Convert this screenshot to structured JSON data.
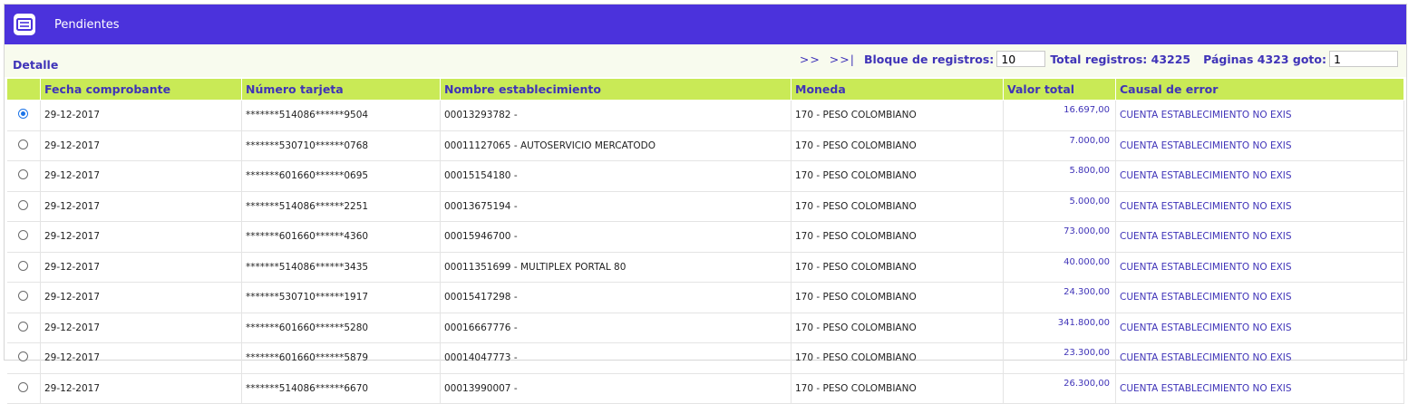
{
  "header": {
    "title": "Pendientes",
    "icon": "list-card-icon"
  },
  "toolbar": {
    "detail_label": "Detalle",
    "next_label": ">>",
    "last_label": ">>|",
    "block_label": "Bloque de registros:",
    "block_value": "10",
    "total_label": "Total registros: 43225",
    "pages_label": "Páginas 4323 goto:",
    "goto_value": "1"
  },
  "columns": [
    "",
    "Fecha comprobante",
    "Número tarjeta",
    "Nombre establecimiento",
    "Moneda",
    "Valor total",
    "Causal de error"
  ],
  "rows": [
    {
      "selected": true,
      "fecha": "29-12-2017",
      "tarjeta": "*******514086******9504",
      "establecimiento": "00013293782 -",
      "moneda": "170 - PESO COLOMBIANO",
      "valor": "16.697,00",
      "causal": "CUENTA ESTABLECIMIENTO NO EXIS"
    },
    {
      "selected": false,
      "fecha": "29-12-2017",
      "tarjeta": "*******530710******0768",
      "establecimiento": "00011127065 - AUTOSERVICIO MERCATODO",
      "moneda": "170 - PESO COLOMBIANO",
      "valor": "7.000,00",
      "causal": "CUENTA ESTABLECIMIENTO NO EXIS"
    },
    {
      "selected": false,
      "fecha": "29-12-2017",
      "tarjeta": "*******601660******0695",
      "establecimiento": "00015154180 -",
      "moneda": "170 - PESO COLOMBIANO",
      "valor": "5.800,00",
      "causal": "CUENTA ESTABLECIMIENTO NO EXIS"
    },
    {
      "selected": false,
      "fecha": "29-12-2017",
      "tarjeta": "*******514086******2251",
      "establecimiento": "00013675194 -",
      "moneda": "170 - PESO COLOMBIANO",
      "valor": "5.000,00",
      "causal": "CUENTA ESTABLECIMIENTO NO EXIS"
    },
    {
      "selected": false,
      "fecha": "29-12-2017",
      "tarjeta": "*******601660******4360",
      "establecimiento": "00015946700 -",
      "moneda": "170 - PESO COLOMBIANO",
      "valor": "73.000,00",
      "causal": "CUENTA ESTABLECIMIENTO NO EXIS"
    },
    {
      "selected": false,
      "fecha": "29-12-2017",
      "tarjeta": "*******514086******3435",
      "establecimiento": "00011351699 - MULTIPLEX PORTAL 80",
      "moneda": "170 - PESO COLOMBIANO",
      "valor": "40.000,00",
      "causal": "CUENTA ESTABLECIMIENTO NO EXIS"
    },
    {
      "selected": false,
      "fecha": "29-12-2017",
      "tarjeta": "*******530710******1917",
      "establecimiento": "00015417298 -",
      "moneda": "170 - PESO COLOMBIANO",
      "valor": "24.300,00",
      "causal": "CUENTA ESTABLECIMIENTO NO EXIS"
    },
    {
      "selected": false,
      "fecha": "29-12-2017",
      "tarjeta": "*******601660******5280",
      "establecimiento": "00016667776 -",
      "moneda": "170 - PESO COLOMBIANO",
      "valor": "341.800,00",
      "causal": "CUENTA ESTABLECIMIENTO NO EXIS"
    },
    {
      "selected": false,
      "fecha": "29-12-2017",
      "tarjeta": "*******601660******5879",
      "establecimiento": "00014047773 -",
      "moneda": "170 - PESO COLOMBIANO",
      "valor": "23.300,00",
      "causal": "CUENTA ESTABLECIMIENTO NO EXIS"
    },
    {
      "selected": false,
      "fecha": "29-12-2017",
      "tarjeta": "*******514086******6670",
      "establecimiento": "00013990007 -",
      "moneda": "170 - PESO COLOMBIANO",
      "valor": "26.300,00",
      "causal": "CUENTA ESTABLECIMIENTO NO EXIS"
    }
  ],
  "colors": {
    "header": "#4b32dc",
    "table_header": "#c9ea56",
    "accent_text": "#3f33b8",
    "toolbar_bg": "#f8fbee"
  }
}
